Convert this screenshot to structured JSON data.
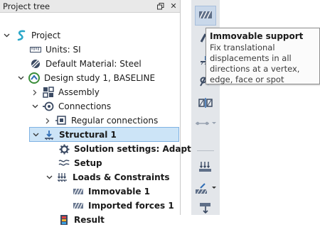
{
  "panel": {
    "title": "Project tree",
    "dock_icon": "restore-icon",
    "close_glyph": "✕"
  },
  "tree": {
    "project": "Project",
    "units": "Units: SI",
    "default_material": "Default Material: Steel",
    "design_study": "Design study 1, BASELINE",
    "assembly": "Assembly",
    "connections": "Connections",
    "regular_connections": "Regular connections",
    "structural": "Structural 1",
    "solution_settings": "Solution settings: Adapt...",
    "setup": "Setup",
    "loads_constraints": "Loads & Constraints",
    "immovable": "Immovable 1",
    "imported_forces": "Imported forces 1",
    "result": "Result"
  },
  "tooltip": {
    "title": "Immovable support",
    "body": "Fix translational displacements in all directions at a vertex, edge, face or spot"
  },
  "colors": {
    "accent": "#2f6db5",
    "selection": "#cce4f7",
    "toolbar": "#e3e6ea"
  }
}
